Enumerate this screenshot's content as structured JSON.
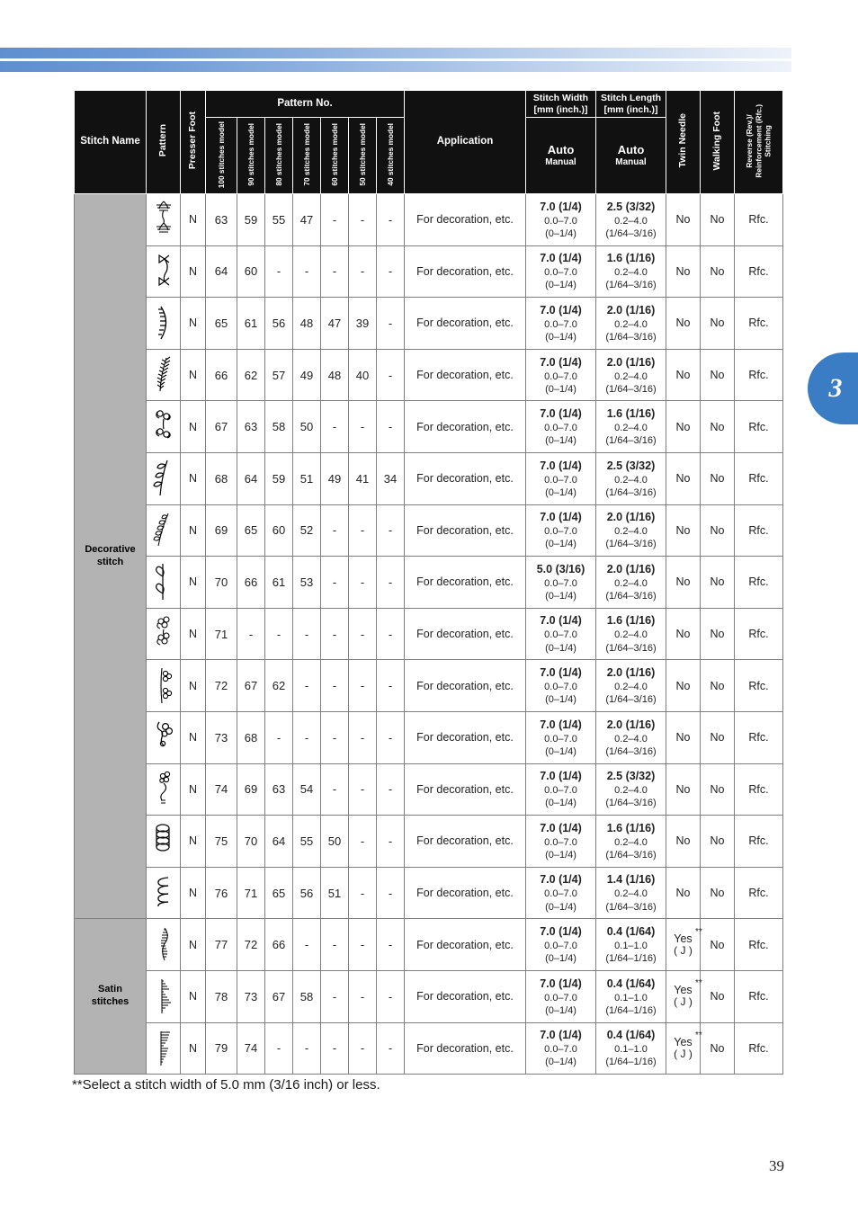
{
  "page": {
    "number": "39",
    "chapter_tab": "3",
    "footnote": "**Select a stitch width of 5.0 mm (3/16 inch) or less.",
    "accent_color": "#3a7dc4",
    "banner_gradient_start": "#5f8fd0",
    "banner_gradient_end": "#eef3fb",
    "header_bg": "#111111",
    "group_bg": "#b3b3b3"
  },
  "table": {
    "headers": {
      "stitch_name": "Stitch Name",
      "pattern": "Pattern",
      "presser_foot": "Presser Foot",
      "pattern_no": "Pattern No.",
      "models": [
        "100 stitches\nmodel",
        "90 stitches\nmodel",
        "80 stitches\nmodel",
        "70 stitches\nmodel",
        "60 stitches\nmodel",
        "50 stitches\nmodel",
        "40 stitches\nmodel"
      ],
      "models_flat": [
        "100 stitches model",
        "90 stitches model",
        "80 stitches model",
        "70 stitches model",
        "60 stitches model",
        "50 stitches model",
        "40 stitches model"
      ],
      "application": "Application",
      "stitch_width": "Stitch Width",
      "stitch_width_unit": "[mm (inch.)]",
      "stitch_length": "Stitch Length",
      "stitch_length_unit": "[mm (inch.)]",
      "auto": "Auto",
      "manual": "Manual",
      "twin_needle": "Twin Needle",
      "walking_foot": "Walking Foot",
      "reverse_stitching": "Reverse (Rev.)/\nReinforcement (Rfc.)\nStitching",
      "reverse_line1": "Reverse (Rev.)/",
      "reverse_line2": "Reinforcement (Rfc.)",
      "reverse_line3": "Stitching"
    },
    "groups": [
      {
        "label": "Decorative\nstitch",
        "label_line1": "Decorative",
        "label_line2": "stitch",
        "rows": 14
      },
      {
        "label": "Satin\nstitches",
        "label_line1": "Satin",
        "label_line2": "stitches",
        "rows": 3
      }
    ],
    "rows": [
      {
        "pattern_icon": "leafy-sprig-stitch-icon",
        "presser_foot": "N",
        "numbers": [
          "63",
          "59",
          "55",
          "47",
          "-",
          "-",
          "-"
        ],
        "application": "For decoration, etc.",
        "width_auto": "7.0 (1/4)",
        "width_range": "0.0–7.0",
        "width_range_inch": "(0–1/4)",
        "length_auto": "2.5 (3/32)",
        "length_range": "0.2–4.0",
        "length_range_inch": "(1/64–3/16)",
        "twin_needle": "No",
        "walking_foot": "No",
        "reverse": "Rfc."
      },
      {
        "pattern_icon": "bow-ribbon-stitch-icon",
        "presser_foot": "N",
        "numbers": [
          "64",
          "60",
          "-",
          "-",
          "-",
          "-",
          "-"
        ],
        "application": "For decoration, etc.",
        "width_auto": "7.0 (1/4)",
        "width_range": "0.0–7.0",
        "width_range_inch": "(0–1/4)",
        "length_auto": "1.6 (1/16)",
        "length_range": "0.2–4.0",
        "length_range_inch": "(1/64–3/16)",
        "twin_needle": "No",
        "walking_foot": "No",
        "reverse": "Rfc."
      },
      {
        "pattern_icon": "crescent-comb-stitch-icon",
        "presser_foot": "N",
        "numbers": [
          "65",
          "61",
          "56",
          "48",
          "47",
          "39",
          "-"
        ],
        "application": "For decoration, etc.",
        "width_auto": "7.0 (1/4)",
        "width_range": "0.0–7.0",
        "width_range_inch": "(0–1/4)",
        "length_auto": "2.0 (1/16)",
        "length_range": "0.2–4.0",
        "length_range_inch": "(1/64–3/16)",
        "twin_needle": "No",
        "walking_foot": "No",
        "reverse": "Rfc."
      },
      {
        "pattern_icon": "feather-fern-stitch-icon",
        "presser_foot": "N",
        "numbers": [
          "66",
          "62",
          "57",
          "49",
          "48",
          "40",
          "-"
        ],
        "application": "For decoration, etc.",
        "width_auto": "7.0 (1/4)",
        "width_range": "0.0–7.0",
        "width_range_inch": "(0–1/4)",
        "length_auto": "2.0 (1/16)",
        "length_range": "0.2–4.0",
        "length_range_inch": "(1/64–3/16)",
        "twin_needle": "No",
        "walking_foot": "No",
        "reverse": "Rfc."
      },
      {
        "pattern_icon": "double-scroll-stitch-icon",
        "presser_foot": "N",
        "numbers": [
          "67",
          "63",
          "58",
          "50",
          "-",
          "-",
          "-"
        ],
        "application": "For decoration, etc.",
        "width_auto": "7.0 (1/4)",
        "width_range": "0.0–7.0",
        "width_range_inch": "(0–1/4)",
        "length_auto": "1.6 (1/16)",
        "length_range": "0.2–4.0",
        "length_range_inch": "(1/64–3/16)",
        "twin_needle": "No",
        "walking_foot": "No",
        "reverse": "Rfc."
      },
      {
        "pattern_icon": "leaf-vine-stitch-icon",
        "presser_foot": "N",
        "numbers": [
          "68",
          "64",
          "59",
          "51",
          "49",
          "41",
          "34"
        ],
        "application": "For decoration, etc.",
        "width_auto": "7.0 (1/4)",
        "width_range": "0.0–7.0",
        "width_range_inch": "(0–1/4)",
        "length_auto": "2.5 (3/32)",
        "length_range": "0.2–4.0",
        "length_range_inch": "(1/64–3/16)",
        "twin_needle": "No",
        "walking_foot": "No",
        "reverse": "Rfc."
      },
      {
        "pattern_icon": "wheat-sheaf-stitch-icon",
        "presser_foot": "N",
        "numbers": [
          "69",
          "65",
          "60",
          "52",
          "-",
          "-",
          "-"
        ],
        "application": "For decoration, etc.",
        "width_auto": "7.0 (1/4)",
        "width_range": "0.0–7.0",
        "width_range_inch": "(0–1/4)",
        "length_auto": "2.0 (1/16)",
        "length_range": "0.2–4.0",
        "length_range_inch": "(1/64–3/16)",
        "twin_needle": "No",
        "walking_foot": "No",
        "reverse": "Rfc."
      },
      {
        "pattern_icon": "heart-vine-stitch-icon",
        "presser_foot": "N",
        "numbers": [
          "70",
          "66",
          "61",
          "53",
          "-",
          "-",
          "-"
        ],
        "application": "For decoration, etc.",
        "width_auto": "5.0 (3/16)",
        "width_range": "0.0–7.0",
        "width_range_inch": "(0–1/4)",
        "length_auto": "2.0 (1/16)",
        "length_range": "0.2–4.0",
        "length_range_inch": "(1/64–3/16)",
        "twin_needle": "No",
        "walking_foot": "No",
        "reverse": "Rfc."
      },
      {
        "pattern_icon": "flower-cluster-stitch-icon",
        "presser_foot": "N",
        "numbers": [
          "71",
          "-",
          "-",
          "-",
          "-",
          "-",
          "-"
        ],
        "application": "For decoration, etc.",
        "width_auto": "7.0 (1/4)",
        "width_range": "0.0–7.0",
        "width_range_inch": "(0–1/4)",
        "length_auto": "1.6 (1/16)",
        "length_range": "0.2–4.0",
        "length_range_inch": "(1/64–3/16)",
        "twin_needle": "No",
        "walking_foot": "No",
        "reverse": "Rfc."
      },
      {
        "pattern_icon": "double-blossom-stitch-icon",
        "presser_foot": "N",
        "numbers": [
          "72",
          "67",
          "62",
          "-",
          "-",
          "-",
          "-"
        ],
        "application": "For decoration, etc.",
        "width_auto": "7.0 (1/4)",
        "width_range": "0.0–7.0",
        "width_range_inch": "(0–1/4)",
        "length_auto": "2.0 (1/16)",
        "length_range": "0.2–4.0",
        "length_range_inch": "(1/64–3/16)",
        "twin_needle": "No",
        "walking_foot": "No",
        "reverse": "Rfc."
      },
      {
        "pattern_icon": "clover-stitch-icon",
        "presser_foot": "N",
        "numbers": [
          "73",
          "68",
          "-",
          "-",
          "-",
          "-",
          "-"
        ],
        "application": "For decoration, etc.",
        "width_auto": "7.0 (1/4)",
        "width_range": "0.0–7.0",
        "width_range_inch": "(0–1/4)",
        "length_auto": "2.0 (1/16)",
        "length_range": "0.2–4.0",
        "length_range_inch": "(1/64–3/16)",
        "twin_needle": "No",
        "walking_foot": "No",
        "reverse": "Rfc."
      },
      {
        "pattern_icon": "flower-stem-stitch-icon",
        "presser_foot": "N",
        "numbers": [
          "74",
          "69",
          "63",
          "54",
          "-",
          "-",
          "-"
        ],
        "application": "For decoration, etc.",
        "width_auto": "7.0 (1/4)",
        "width_range": "0.0–7.0",
        "width_range_inch": "(0–1/4)",
        "length_auto": "2.5 (3/32)",
        "length_range": "0.2–4.0",
        "length_range_inch": "(1/64–3/16)",
        "twin_needle": "No",
        "walking_foot": "No",
        "reverse": "Rfc."
      },
      {
        "pattern_icon": "spiral-coil-stitch-icon",
        "presser_foot": "N",
        "numbers": [
          "75",
          "70",
          "64",
          "55",
          "50",
          "-",
          "-"
        ],
        "application": "For decoration, etc.",
        "width_auto": "7.0 (1/4)",
        "width_range": "0.0–7.0",
        "width_range_inch": "(0–1/4)",
        "length_auto": "1.6 (1/16)",
        "length_range": "0.2–4.0",
        "length_range_inch": "(1/64–3/16)",
        "twin_needle": "No",
        "walking_foot": "No",
        "reverse": "Rfc."
      },
      {
        "pattern_icon": "wavy-loop-stitch-icon",
        "presser_foot": "N",
        "numbers": [
          "76",
          "71",
          "65",
          "56",
          "51",
          "-",
          "-"
        ],
        "application": "For decoration, etc.",
        "width_auto": "7.0 (1/4)",
        "width_range": "0.0–7.0",
        "width_range_inch": "(0–1/4)",
        "length_auto": "1.4 (1/16)",
        "length_range": "0.2–4.0",
        "length_range_inch": "(1/64–3/16)",
        "twin_needle": "No",
        "walking_foot": "No",
        "reverse": "Rfc."
      },
      {
        "pattern_icon": "satin-wave-stitch-icon",
        "presser_foot": "N",
        "numbers": [
          "77",
          "72",
          "66",
          "-",
          "-",
          "-",
          "-"
        ],
        "application": "For decoration, etc.",
        "width_auto": "7.0 (1/4)",
        "width_range": "0.0–7.0",
        "width_range_inch": "(0–1/4)",
        "length_auto": "0.4 (1/64)",
        "length_range": "0.1–1.0",
        "length_range_inch": "(1/64–1/16)",
        "twin_needle": "Yes",
        "twin_needle_note": "**",
        "twin_needle_sub": "( J )",
        "walking_foot": "No",
        "reverse": "Rfc."
      },
      {
        "pattern_icon": "satin-triangle-stitch-icon",
        "presser_foot": "N",
        "numbers": [
          "78",
          "73",
          "67",
          "58",
          "-",
          "-",
          "-"
        ],
        "application": "For decoration, etc.",
        "width_auto": "7.0 (1/4)",
        "width_range": "0.0–7.0",
        "width_range_inch": "(0–1/4)",
        "length_auto": "0.4 (1/64)",
        "length_range": "0.1–1.0",
        "length_range_inch": "(1/64–1/16)",
        "twin_needle": "Yes",
        "twin_needle_note": "**",
        "twin_needle_sub": "( J )",
        "walking_foot": "No",
        "reverse": "Rfc."
      },
      {
        "pattern_icon": "satin-fan-stitch-icon",
        "presser_foot": "N",
        "numbers": [
          "79",
          "74",
          "-",
          "-",
          "-",
          "-",
          "-"
        ],
        "application": "For decoration, etc.",
        "width_auto": "7.0 (1/4)",
        "width_range": "0.0–7.0",
        "width_range_inch": "(0–1/4)",
        "length_auto": "0.4 (1/64)",
        "length_range": "0.1–1.0",
        "length_range_inch": "(1/64–1/16)",
        "twin_needle": "Yes",
        "twin_needle_note": "**",
        "twin_needle_sub": "( J )",
        "walking_foot": "No",
        "reverse": "Rfc."
      }
    ]
  }
}
